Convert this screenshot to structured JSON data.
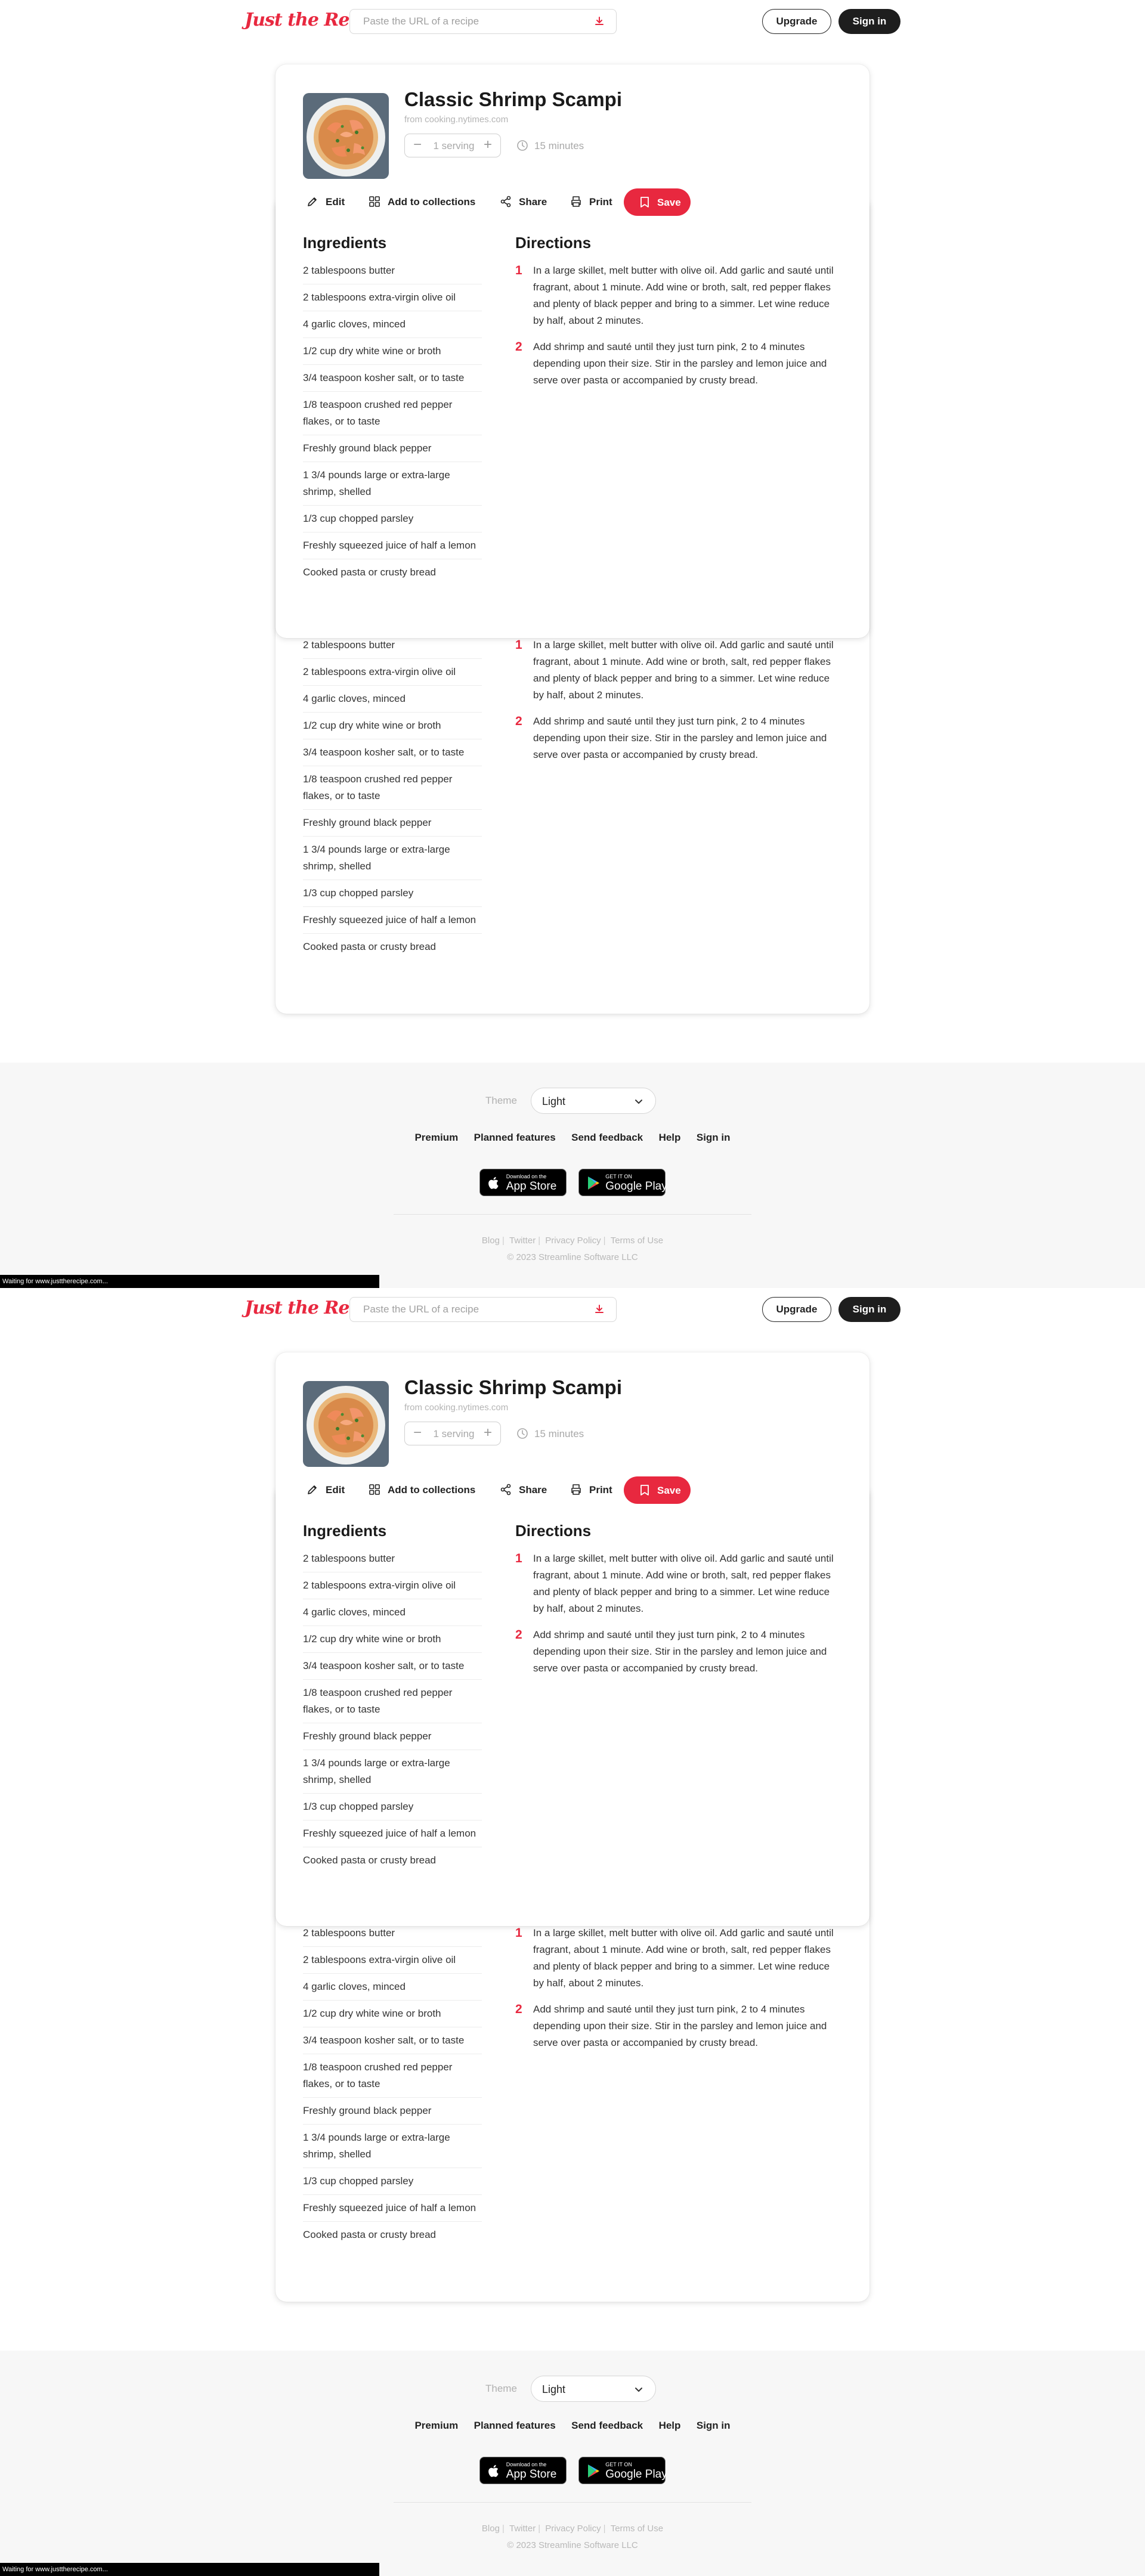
{
  "header": {
    "logo": "Just the Recipe",
    "search_placeholder": "Paste the URL of a recipe",
    "upgrade_label": "Upgrade",
    "signin_label": "Sign in"
  },
  "recipe": {
    "title": "Classic Shrimp Scampi",
    "source": "from cooking.nytimes.com",
    "servings": "1 serving",
    "time": "15 minutes",
    "photo": "shrimp-scampi-photo"
  },
  "actions": {
    "edit": "Edit",
    "collections": "Add to collections",
    "share": "Share",
    "print": "Print",
    "save": "Save"
  },
  "ingredients_heading": "Ingredients",
  "directions_heading": "Directions",
  "ingredients": [
    "2 tablespoons butter",
    "2 tablespoons extra-virgin olive oil",
    "4 garlic cloves, minced",
    "1/2 cup dry white wine or broth",
    "3/4 teaspoon kosher salt, or to taste",
    "1/8 teaspoon crushed red pepper flakes, or to taste",
    "Freshly ground black pepper",
    "1 3/4 pounds large or extra-large shrimp, shelled",
    "1/3 cup chopped parsley",
    "Freshly squeezed juice of half a lemon",
    "Cooked pasta or crusty bread"
  ],
  "directions": [
    {
      "num": "1",
      "text": "In a large skillet, melt butter with olive oil. Add garlic and sauté until fragrant, about 1 minute. Add wine or broth, salt, red pepper flakes and plenty of black pepper and bring to a simmer. Let wine reduce by half, about 2 minutes."
    },
    {
      "num": "2",
      "text": "Add shrimp and sauté until they just turn pink, 2 to 4 minutes depending upon their size. Stir in the parsley and lemon juice and serve over pasta or accompanied by crusty bread."
    }
  ],
  "footer": {
    "theme_label": "Theme",
    "theme_value": "Light",
    "nav": [
      "Premium",
      "Planned features",
      "Send feedback",
      "Help",
      "Sign in"
    ],
    "app_store_small": "Download on the",
    "app_store_big": "App Store",
    "google_play_small": "GET IT ON",
    "google_play_big": "Google Play",
    "links": [
      "Blog",
      "Twitter",
      "Privacy Policy",
      "Terms of Use"
    ],
    "copyright": "© 2023 Streamline Software LLC"
  },
  "status": "Waiting for www.justtherecipe.com...",
  "colors": {
    "accent": "#e8283f",
    "dark": "#1e1e1e",
    "footer_bg": "#f7f7f7"
  }
}
